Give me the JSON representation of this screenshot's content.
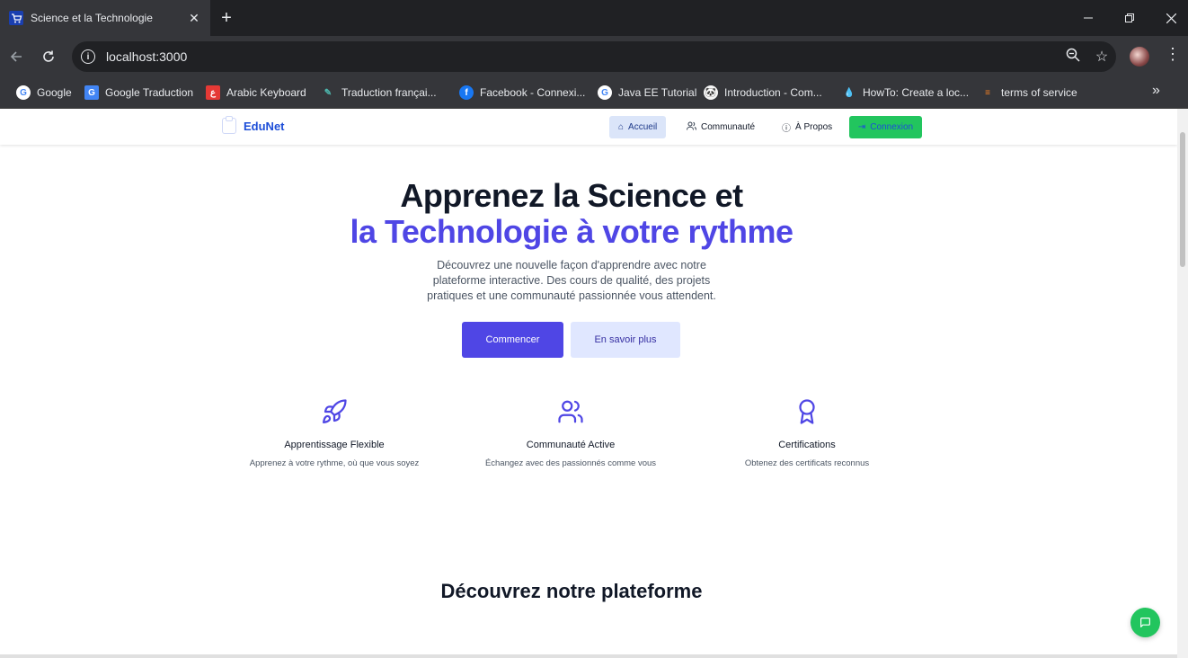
{
  "browser": {
    "tab_title": "Science et la Technologie",
    "url": "localhost:3000",
    "bookmarks": [
      {
        "label": "Google",
        "icon": "google-icon"
      },
      {
        "label": "Google Traduction",
        "icon": "google-translate-icon"
      },
      {
        "label": "Arabic Keyboard",
        "icon": "arabic-keyboard-icon"
      },
      {
        "label": "Traduction françai...",
        "icon": "translation-icon"
      },
      {
        "label": "Facebook - Connexi...",
        "icon": "facebook-icon"
      },
      {
        "label": "Java EE Tutorial",
        "icon": "google-icon"
      },
      {
        "label": "Introduction - Com...",
        "icon": "panda-icon"
      },
      {
        "label": "HowTo: Create a loc...",
        "icon": "drupal-icon"
      },
      {
        "label": "terms of service",
        "icon": "stackoverflow-icon"
      }
    ]
  },
  "nav": {
    "brand": "EduNet",
    "links": {
      "home": "Accueil",
      "community": "Communauté",
      "about": "À Propos",
      "login": "Connexion"
    }
  },
  "hero": {
    "title_line1": "Apprenez la Science et",
    "title_line2": "la Technologie à votre rythme",
    "subtitle": "Découvrez une nouvelle façon d'apprendre avec notre plateforme interactive. Des cours de qualité, des projets pratiques et une communauté passionnée vous attendent.",
    "primary_button": "Commencer",
    "secondary_button": "En savoir plus"
  },
  "features": [
    {
      "title": "Apprentissage Flexible",
      "description": "Apprenez à votre rythme, où que vous soyez",
      "icon": "rocket-icon"
    },
    {
      "title": "Communauté Active",
      "description": "Échangez avec des passionnés comme vous",
      "icon": "users-icon"
    },
    {
      "title": "Certifications",
      "description": "Obtenez des certificats reconnus",
      "icon": "award-icon"
    }
  ],
  "section": {
    "title": "Découvrez notre plateforme"
  },
  "colors": {
    "accent": "#4f46e5",
    "accent_light": "#e0e7ff",
    "success": "#22c55e",
    "brand": "#1d4ed8"
  }
}
